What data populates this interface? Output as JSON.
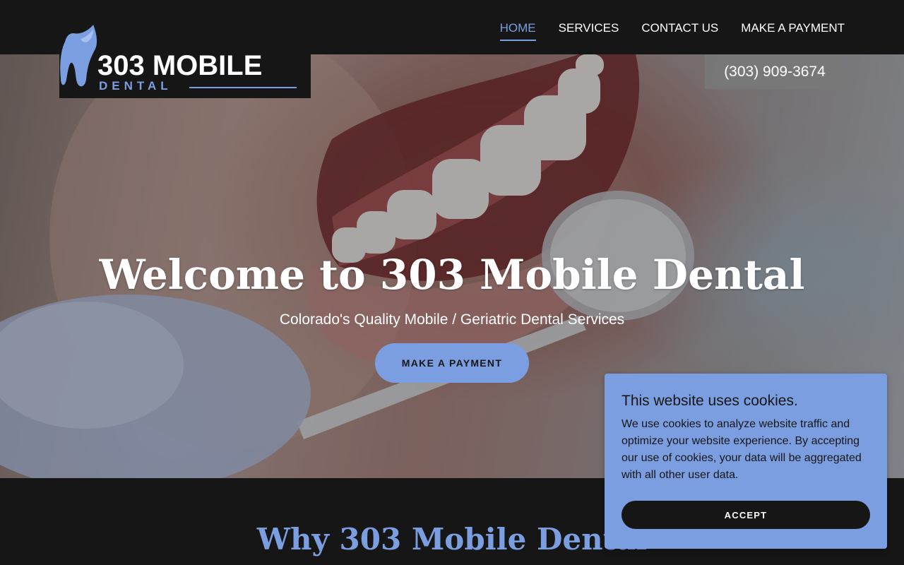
{
  "brand": {
    "name_main": "303 MOBILE",
    "name_sub": "DENTAL",
    "logo_icon": "tooth-icon",
    "accent_color": "#7b9ee0",
    "dark_color": "#161616"
  },
  "nav": {
    "items": [
      {
        "label": "HOME",
        "active": true
      },
      {
        "label": "SERVICES",
        "active": false
      },
      {
        "label": "CONTACT US",
        "active": false
      },
      {
        "label": "MAKE A PAYMENT",
        "active": false
      }
    ]
  },
  "header": {
    "phone": "(303) 909-3674"
  },
  "hero": {
    "title": "Welcome to 303 Mobile Dental",
    "subtitle": "Colorado's Quality Mobile / Geriatric Dental Services",
    "button_label": "MAKE A PAYMENT",
    "image": "smiling-mouth-with-dental-mirror-photo"
  },
  "why": {
    "title": "Why 303 Mobile Dental"
  },
  "cookie_banner": {
    "title": "This website uses cookies.",
    "text": "We use cookies to analyze website traffic and optimize your website experience. By accepting our use of cookies, your data will be aggregated with all other user data.",
    "accept_label": "ACCEPT"
  }
}
